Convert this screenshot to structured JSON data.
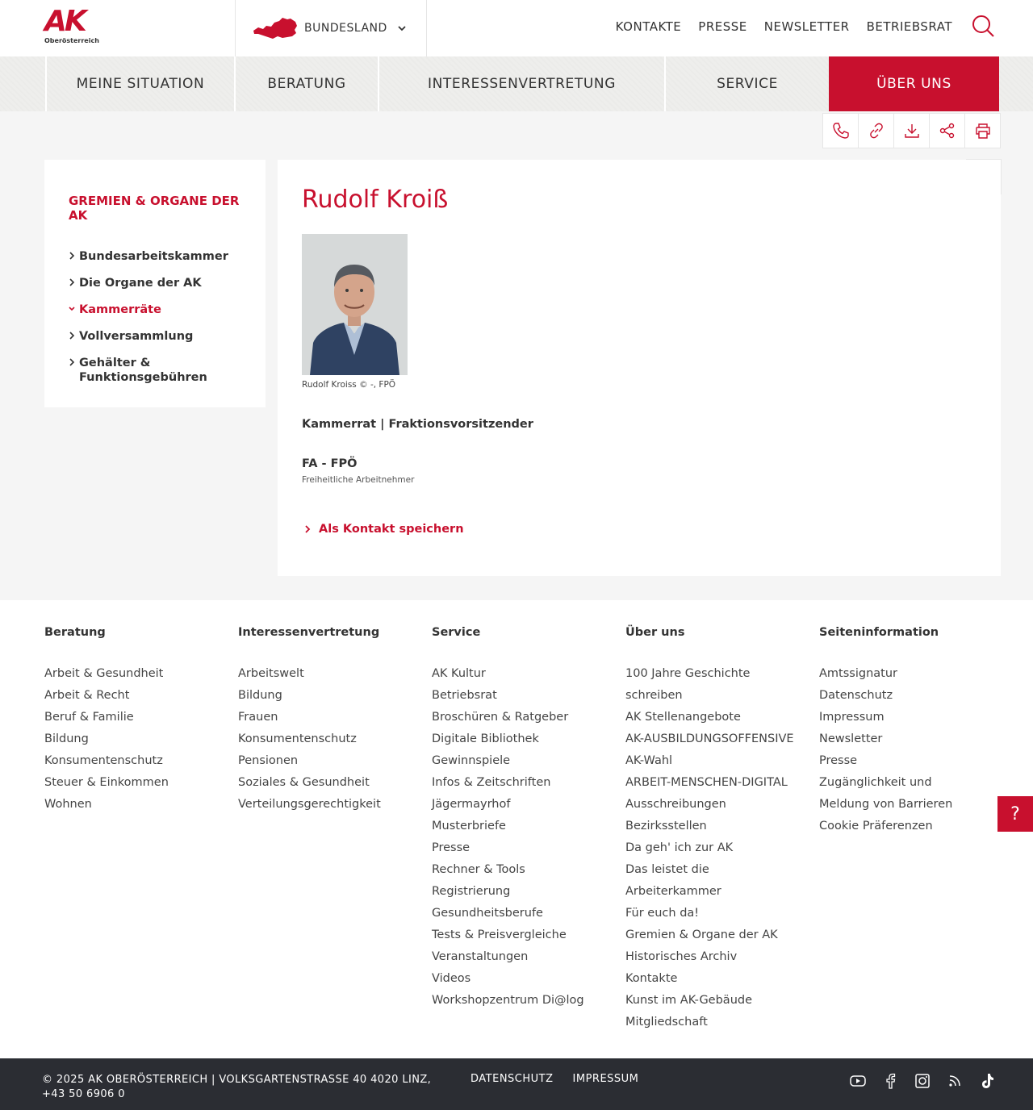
{
  "brand": {
    "logo_text": "AK",
    "logo_sub": "Oberösterreich",
    "accent": "#c8102e"
  },
  "bundesland": {
    "label": "BUNDESLAND"
  },
  "toplinks": [
    "KONTAKTE",
    "PRESSE",
    "NEWSLETTER",
    "BETRIEBSRAT"
  ],
  "mainnav": [
    "MEINE SITUATION",
    "BERATUNG",
    "INTERESSENVERTRETUNG",
    "SERVICE",
    "ÜBER UNS"
  ],
  "sidebar": {
    "title": "GREMIEN & ORGANE DER AK",
    "items": [
      "Bundesarbeitskammer",
      "Die Organe der AK",
      "Kammerräte",
      "Vollversammlung",
      "Gehälter & Funktionsgebühren"
    ],
    "active_item": "Kammerräte"
  },
  "profile": {
    "name": "Rudolf Kroiß",
    "photo_caption": "Rudolf Kroiss © -, FPÖ",
    "role": "Kammerrat | Fraktionsvorsitzender",
    "party": "FA - FPÖ",
    "party_sub": "Freiheitliche Arbeitnehmer",
    "save_contact": "Als Kontakt speichern"
  },
  "footer": {
    "columns": [
      {
        "title": "Beratung",
        "links": [
          "Arbeit & Gesundheit",
          "Arbeit & Recht",
          "Beruf & Familie",
          "Bildung",
          "Konsumentenschutz",
          "Steuer & Einkommen",
          "Wohnen"
        ]
      },
      {
        "title": "Interessenvertretung",
        "links": [
          "Arbeitswelt",
          "Bildung",
          "Frauen",
          "Konsumentenschutz",
          "Pensionen",
          "Soziales & Gesundheit",
          "Verteilungsgerechtigkeit"
        ]
      },
      {
        "title": "Service",
        "links": [
          "AK Kultur",
          "Betriebsrat",
          "Broschüren & Ratgeber",
          "Digitale Bibliothek",
          "Gewinnspiele",
          "Infos & Zeitschriften",
          "Jägermayrhof",
          "Musterbriefe",
          "Presse",
          "Rechner & Tools",
          "Registrierung Gesundheitsberufe",
          "Tests & Preisvergleiche",
          "Veranstaltungen",
          "Videos",
          "Workshopzentrum Di@log"
        ]
      },
      {
        "title": "Über uns",
        "links": [
          "100 Jahre Geschichte schreiben",
          "AK Stellenangebote",
          "AK-AUSBILDUNGSOFFENSIVE",
          "AK-Wahl",
          "ARBEIT-MENSCHEN-DIGITAL",
          "Ausschreibungen",
          "Bezirksstellen",
          "Da geh' ich zur AK",
          "Das leistet die Arbeiterkammer",
          "Für euch da!",
          "Gremien & Organe der AK",
          "Historisches Archiv",
          "Kontakte",
          "Kunst im AK-Gebäude",
          "Mitgliedschaft"
        ]
      },
      {
        "title": "Seiteninformation",
        "links": [
          "Amtssignatur",
          "Datenschutz",
          "Impressum",
          "Newsletter",
          "Presse",
          "Zugänglichkeit und Meldung von Barrieren",
          "Cookie Präferenzen"
        ]
      }
    ]
  },
  "help": {
    "label": "?"
  },
  "bottombar": {
    "copyright": "© 2025 AK OBERÖSTERREICH | VOLKSGARTENSTRASSE 40 4020 LINZ, +43 50 6906 0",
    "links": [
      "DATENSCHUTZ",
      "IMPRESSUM"
    ],
    "social": [
      "youtube-icon",
      "facebook-icon",
      "instagram-icon",
      "rss-icon",
      "tiktok-icon"
    ]
  }
}
